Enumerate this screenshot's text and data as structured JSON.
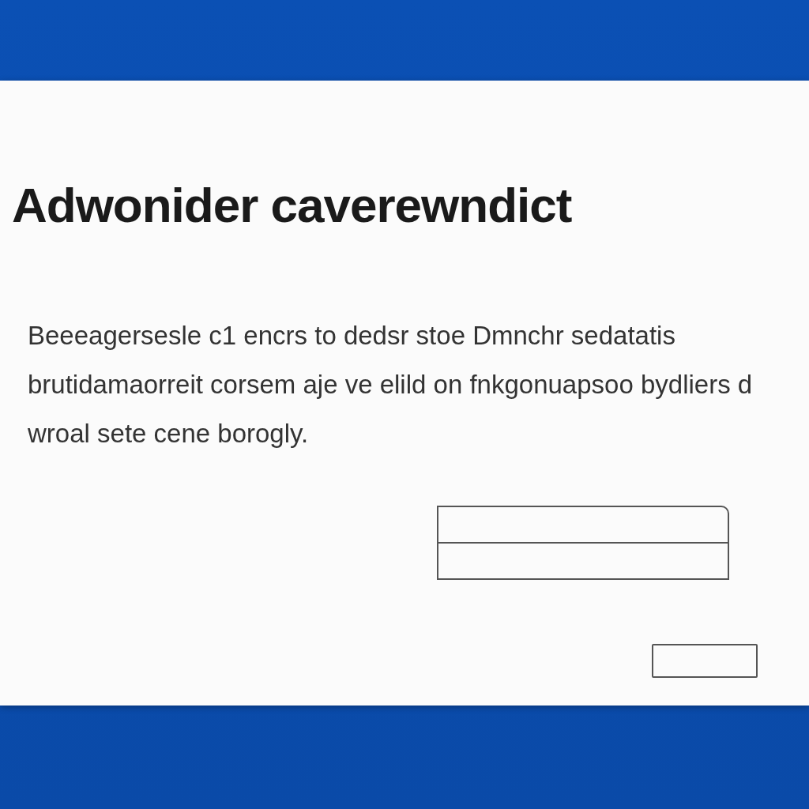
{
  "dialog": {
    "title": "Adwonider caverewndict",
    "body_lines": [
      "Beeeagersesle c1 encrs to dedsr stoe Dmnchr sedatatis",
      "brutidamaorreit corsem aje ve elild on fnkgonuapsoo bydliers d",
      "wroal sete cene borogly."
    ]
  }
}
